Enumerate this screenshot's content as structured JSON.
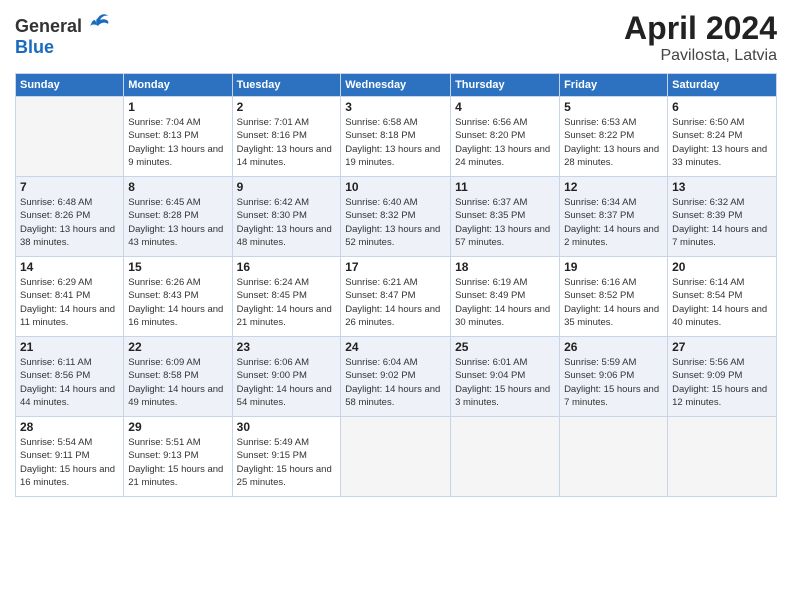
{
  "logo": {
    "general": "General",
    "blue": "Blue"
  },
  "title": {
    "month": "April 2024",
    "location": "Pavilosta, Latvia"
  },
  "weekdays": [
    "Sunday",
    "Monday",
    "Tuesday",
    "Wednesday",
    "Thursday",
    "Friday",
    "Saturday"
  ],
  "weeks": [
    [
      {
        "day": "",
        "sunrise": "",
        "sunset": "",
        "daylight": ""
      },
      {
        "day": "1",
        "sunrise": "Sunrise: 7:04 AM",
        "sunset": "Sunset: 8:13 PM",
        "daylight": "Daylight: 13 hours and 9 minutes."
      },
      {
        "day": "2",
        "sunrise": "Sunrise: 7:01 AM",
        "sunset": "Sunset: 8:16 PM",
        "daylight": "Daylight: 13 hours and 14 minutes."
      },
      {
        "day": "3",
        "sunrise": "Sunrise: 6:58 AM",
        "sunset": "Sunset: 8:18 PM",
        "daylight": "Daylight: 13 hours and 19 minutes."
      },
      {
        "day": "4",
        "sunrise": "Sunrise: 6:56 AM",
        "sunset": "Sunset: 8:20 PM",
        "daylight": "Daylight: 13 hours and 24 minutes."
      },
      {
        "day": "5",
        "sunrise": "Sunrise: 6:53 AM",
        "sunset": "Sunset: 8:22 PM",
        "daylight": "Daylight: 13 hours and 28 minutes."
      },
      {
        "day": "6",
        "sunrise": "Sunrise: 6:50 AM",
        "sunset": "Sunset: 8:24 PM",
        "daylight": "Daylight: 13 hours and 33 minutes."
      }
    ],
    [
      {
        "day": "7",
        "sunrise": "Sunrise: 6:48 AM",
        "sunset": "Sunset: 8:26 PM",
        "daylight": "Daylight: 13 hours and 38 minutes."
      },
      {
        "day": "8",
        "sunrise": "Sunrise: 6:45 AM",
        "sunset": "Sunset: 8:28 PM",
        "daylight": "Daylight: 13 hours and 43 minutes."
      },
      {
        "day": "9",
        "sunrise": "Sunrise: 6:42 AM",
        "sunset": "Sunset: 8:30 PM",
        "daylight": "Daylight: 13 hours and 48 minutes."
      },
      {
        "day": "10",
        "sunrise": "Sunrise: 6:40 AM",
        "sunset": "Sunset: 8:32 PM",
        "daylight": "Daylight: 13 hours and 52 minutes."
      },
      {
        "day": "11",
        "sunrise": "Sunrise: 6:37 AM",
        "sunset": "Sunset: 8:35 PM",
        "daylight": "Daylight: 13 hours and 57 minutes."
      },
      {
        "day": "12",
        "sunrise": "Sunrise: 6:34 AM",
        "sunset": "Sunset: 8:37 PM",
        "daylight": "Daylight: 14 hours and 2 minutes."
      },
      {
        "day": "13",
        "sunrise": "Sunrise: 6:32 AM",
        "sunset": "Sunset: 8:39 PM",
        "daylight": "Daylight: 14 hours and 7 minutes."
      }
    ],
    [
      {
        "day": "14",
        "sunrise": "Sunrise: 6:29 AM",
        "sunset": "Sunset: 8:41 PM",
        "daylight": "Daylight: 14 hours and 11 minutes."
      },
      {
        "day": "15",
        "sunrise": "Sunrise: 6:26 AM",
        "sunset": "Sunset: 8:43 PM",
        "daylight": "Daylight: 14 hours and 16 minutes."
      },
      {
        "day": "16",
        "sunrise": "Sunrise: 6:24 AM",
        "sunset": "Sunset: 8:45 PM",
        "daylight": "Daylight: 14 hours and 21 minutes."
      },
      {
        "day": "17",
        "sunrise": "Sunrise: 6:21 AM",
        "sunset": "Sunset: 8:47 PM",
        "daylight": "Daylight: 14 hours and 26 minutes."
      },
      {
        "day": "18",
        "sunrise": "Sunrise: 6:19 AM",
        "sunset": "Sunset: 8:49 PM",
        "daylight": "Daylight: 14 hours and 30 minutes."
      },
      {
        "day": "19",
        "sunrise": "Sunrise: 6:16 AM",
        "sunset": "Sunset: 8:52 PM",
        "daylight": "Daylight: 14 hours and 35 minutes."
      },
      {
        "day": "20",
        "sunrise": "Sunrise: 6:14 AM",
        "sunset": "Sunset: 8:54 PM",
        "daylight": "Daylight: 14 hours and 40 minutes."
      }
    ],
    [
      {
        "day": "21",
        "sunrise": "Sunrise: 6:11 AM",
        "sunset": "Sunset: 8:56 PM",
        "daylight": "Daylight: 14 hours and 44 minutes."
      },
      {
        "day": "22",
        "sunrise": "Sunrise: 6:09 AM",
        "sunset": "Sunset: 8:58 PM",
        "daylight": "Daylight: 14 hours and 49 minutes."
      },
      {
        "day": "23",
        "sunrise": "Sunrise: 6:06 AM",
        "sunset": "Sunset: 9:00 PM",
        "daylight": "Daylight: 14 hours and 54 minutes."
      },
      {
        "day": "24",
        "sunrise": "Sunrise: 6:04 AM",
        "sunset": "Sunset: 9:02 PM",
        "daylight": "Daylight: 14 hours and 58 minutes."
      },
      {
        "day": "25",
        "sunrise": "Sunrise: 6:01 AM",
        "sunset": "Sunset: 9:04 PM",
        "daylight": "Daylight: 15 hours and 3 minutes."
      },
      {
        "day": "26",
        "sunrise": "Sunrise: 5:59 AM",
        "sunset": "Sunset: 9:06 PM",
        "daylight": "Daylight: 15 hours and 7 minutes."
      },
      {
        "day": "27",
        "sunrise": "Sunrise: 5:56 AM",
        "sunset": "Sunset: 9:09 PM",
        "daylight": "Daylight: 15 hours and 12 minutes."
      }
    ],
    [
      {
        "day": "28",
        "sunrise": "Sunrise: 5:54 AM",
        "sunset": "Sunset: 9:11 PM",
        "daylight": "Daylight: 15 hours and 16 minutes."
      },
      {
        "day": "29",
        "sunrise": "Sunrise: 5:51 AM",
        "sunset": "Sunset: 9:13 PM",
        "daylight": "Daylight: 15 hours and 21 minutes."
      },
      {
        "day": "30",
        "sunrise": "Sunrise: 5:49 AM",
        "sunset": "Sunset: 9:15 PM",
        "daylight": "Daylight: 15 hours and 25 minutes."
      },
      {
        "day": "",
        "sunrise": "",
        "sunset": "",
        "daylight": ""
      },
      {
        "day": "",
        "sunrise": "",
        "sunset": "",
        "daylight": ""
      },
      {
        "day": "",
        "sunrise": "",
        "sunset": "",
        "daylight": ""
      },
      {
        "day": "",
        "sunrise": "",
        "sunset": "",
        "daylight": ""
      }
    ]
  ]
}
